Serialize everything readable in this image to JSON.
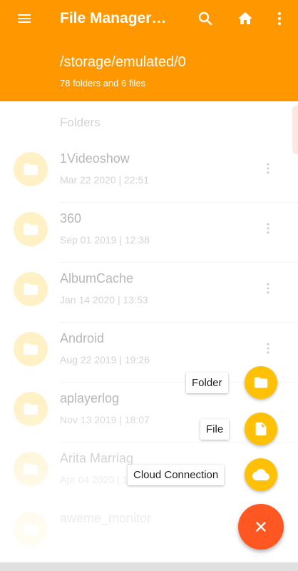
{
  "appbar": {
    "title": "File Manager…",
    "path": "/storage/emulated/0",
    "subtitle": "78 folders and 6 files",
    "icons": [
      "menu-icon",
      "search-icon",
      "home-icon",
      "more-vert-icon"
    ],
    "color": "#ff9800"
  },
  "list": {
    "section_label": "Folders",
    "items": [
      {
        "name": "1Videoshow",
        "meta": "Mar 22 2020 | 22:51"
      },
      {
        "name": "360",
        "meta": "Sep 01 2019 | 12:38"
      },
      {
        "name": "AlbumCache",
        "meta": "Jan 14 2020 | 13:53"
      },
      {
        "name": "Android",
        "meta": "Aug 22 2019 | 19:26"
      },
      {
        "name": "aplayerlog",
        "meta": "Nov 13 2019 | 18:07"
      },
      {
        "name": "Arita Marriag",
        "meta": "Apr 04 2020 | 14:2"
      },
      {
        "name": "aweme_monitor",
        "meta": ""
      }
    ]
  },
  "fab_menu": {
    "folder_label": "Folder",
    "file_label": "File",
    "cloud_label": "Cloud Connection",
    "mini_color": "#ffc107",
    "main_color": "#ff5722"
  }
}
